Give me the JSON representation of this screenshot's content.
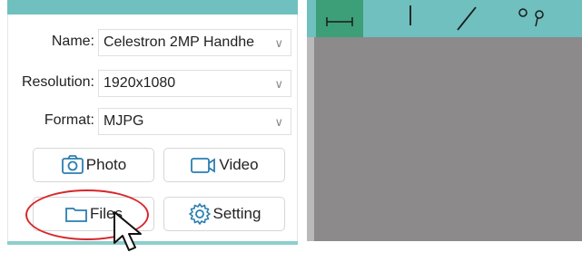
{
  "form": {
    "name_label": "Name:",
    "name_value": "Celestron 2MP Handhe",
    "resolution_label": "Resolution:",
    "resolution_value": "1920x1080",
    "format_label": "Format:",
    "format_value": "MJPG"
  },
  "buttons": {
    "photo": "Photo",
    "video": "Video",
    "files": "Files",
    "setting": "Setting"
  },
  "icons": {
    "chevron": "chevron-down-icon",
    "photo": "camera-icon",
    "video": "video-icon",
    "files": "folder-icon",
    "setting": "gear-icon",
    "toolbar": [
      "horizontal-line-tool-icon",
      "vertical-line-tool-icon",
      "diagonal-line-tool-icon",
      "point-tool-icon"
    ]
  },
  "colors": {
    "toolbar_teal": "#6fc0bf",
    "toolbar_active": "#3d9f77",
    "preview_gray": "#8c8a8b",
    "annotation_red": "#d8262b",
    "icon_blue": "#2a7fb0"
  }
}
